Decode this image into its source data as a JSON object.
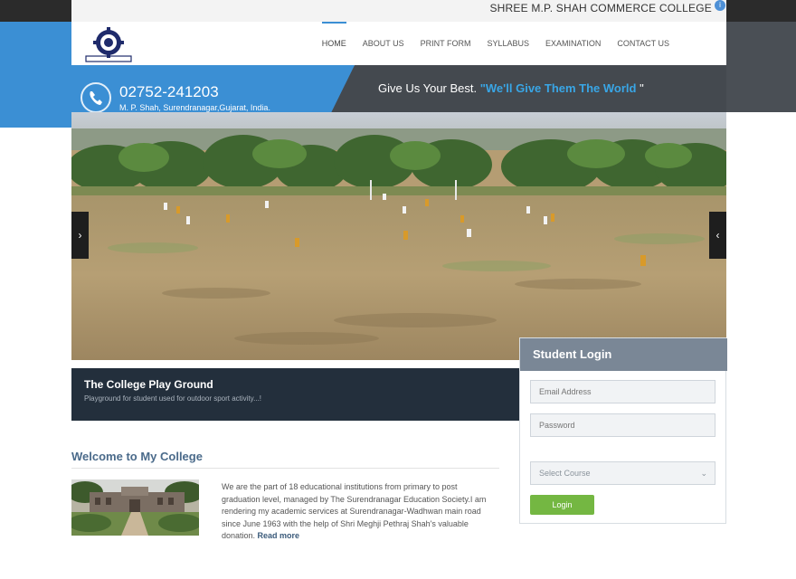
{
  "header": {
    "college_name": "SHREE M.P. SHAH COMMERCE COLLEGE",
    "info_icon": "info-icon"
  },
  "nav": {
    "items": [
      "HOME",
      "ABOUT US",
      "PRINT FORM",
      "SYLLABUS",
      "EXAMINATION",
      "CONTACT US"
    ],
    "active": "HOME"
  },
  "contact": {
    "phone": "02752-241203",
    "address": "M. P. Shah, Surendranagar,Gujarat, India.",
    "phone_icon": "phone-icon"
  },
  "tagline": {
    "prefix": "Give Us Your Best. ",
    "accent": "\"We'll Give Them The World",
    "suffix": " \""
  },
  "slider": {
    "prev_label": "›",
    "next_label": "‹",
    "caption_title": "The College Play Ground",
    "caption_text": "Playground for student used for outdoor sport activity...!"
  },
  "login": {
    "title": "Student Login",
    "email_placeholder": "Email Address",
    "password_placeholder": "Password",
    "course_placeholder": "Select Course",
    "button_label": "Login"
  },
  "welcome": {
    "title": "Welcome to My College",
    "text": "We are the part of 18 educational institutions from primary to post graduation level, managed by The Surendranagar Education Society.I am rendering my academic services at Surendranagar-Wadhwan main road since June 1963 with the help of Shri Meghji Pethraj Shah's valuable donation. ",
    "read_more": "Read more"
  },
  "colors": {
    "brand_blue": "#3b8fd4",
    "dark_band": "#44494f",
    "caption_bg": "#232f3c",
    "login_head": "#7a8796",
    "login_button": "#74b742",
    "tagline_accent": "#39a6e6"
  }
}
